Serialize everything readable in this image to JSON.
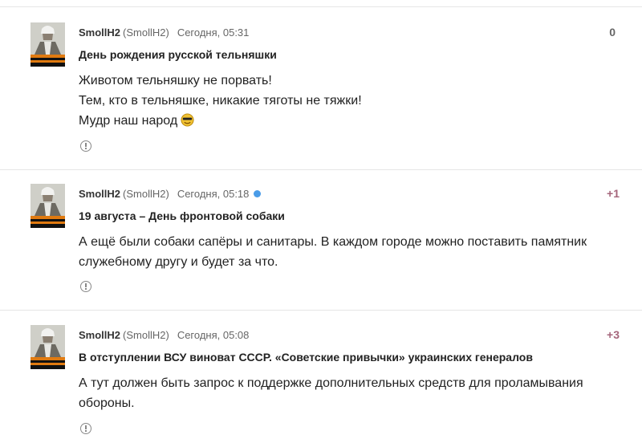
{
  "comments": [
    {
      "author": "SmollH2",
      "login": "(SmollH2)",
      "time": "Сегодня, 05:31",
      "rating": "0",
      "title": "День рождения русской тельняшки",
      "lines": [
        "Животом тельняшку не порвать!",
        "Тем, кто в тельняшке, никакие тяготы не тяжки!",
        "Мудр наш народ"
      ],
      "smiley_icon": "smiley-sunglasses-icon",
      "unread": false
    },
    {
      "author": "SmollH2",
      "login": "(SmollH2)",
      "time": "Сегодня, 05:18",
      "rating": "+1",
      "title": "19 августа – День фронтовой собаки",
      "lines": [
        "А ещё были собаки сапёры и санитары. В каждом городе можно поставить памятник",
        "служебному другу и будет за что."
      ],
      "unread": true
    },
    {
      "author": "SmollH2",
      "login": "(SmollH2)",
      "time": "Сегодня, 05:08",
      "rating": "+3",
      "title": "В отступлении ВСУ виноват СССР. «Советские привычки» украинских генералов",
      "lines": [
        "А тут должен быть запрос к поддержке дополнительных средств для проламывания",
        "обороны."
      ],
      "unread": false
    }
  ],
  "colors": {
    "rating_positive": "#a5657b",
    "rating_zero": "#666666",
    "unread_dot": "#4a9ce8"
  },
  "icons": {
    "report": "exclamation-circle-icon",
    "avatar": "soldier-ribbon-avatar"
  }
}
